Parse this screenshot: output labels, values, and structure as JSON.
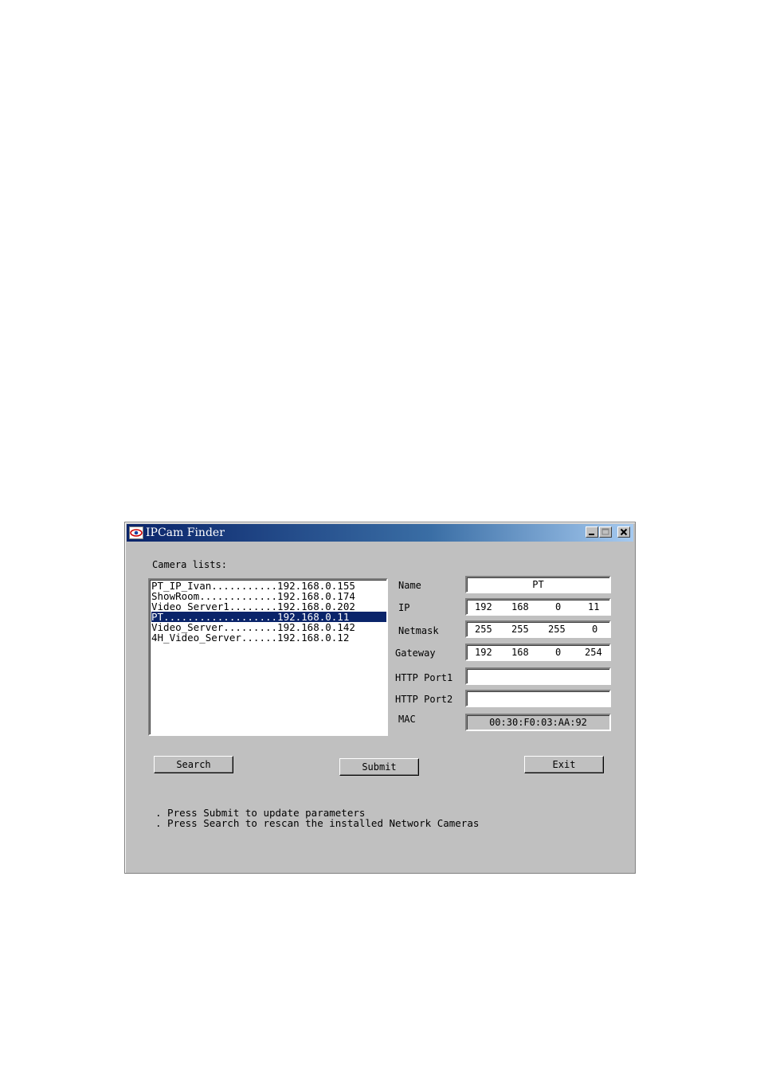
{
  "window": {
    "title": "IPCam Finder"
  },
  "camera_list": {
    "label": "Camera lists:",
    "items": [
      "PT_IP_Ivan...........192.168.0.155",
      "ShowRoom.............192.168.0.174",
      "Video_Server1........192.168.0.202",
      "PT...................192.168.0.11",
      "Video_Server.........192.168.0.142",
      "4H_Video_Server......192.168.0.12"
    ],
    "selected_index": 3
  },
  "fields": {
    "name": {
      "label": "Name",
      "value": "PT"
    },
    "ip": {
      "label": "IP",
      "octets": [
        "192",
        "168",
        "0",
        "11"
      ]
    },
    "netmask": {
      "label": "Netmask",
      "octets": [
        "255",
        "255",
        "255",
        "0"
      ]
    },
    "gateway": {
      "label": "Gateway",
      "octets": [
        "192",
        "168",
        "0",
        "254"
      ]
    },
    "http_port1": {
      "label": "HTTP Port1",
      "value": ""
    },
    "http_port2": {
      "label": "HTTP Port2",
      "value": ""
    },
    "mac": {
      "label": "MAC",
      "value": "00:30:F0:03:AA:92"
    }
  },
  "buttons": {
    "search": "Search",
    "submit": "Submit",
    "exit": "Exit"
  },
  "help": [
    ". Press Submit to update parameters",
    ". Press Search to rescan the installed Network Cameras"
  ]
}
